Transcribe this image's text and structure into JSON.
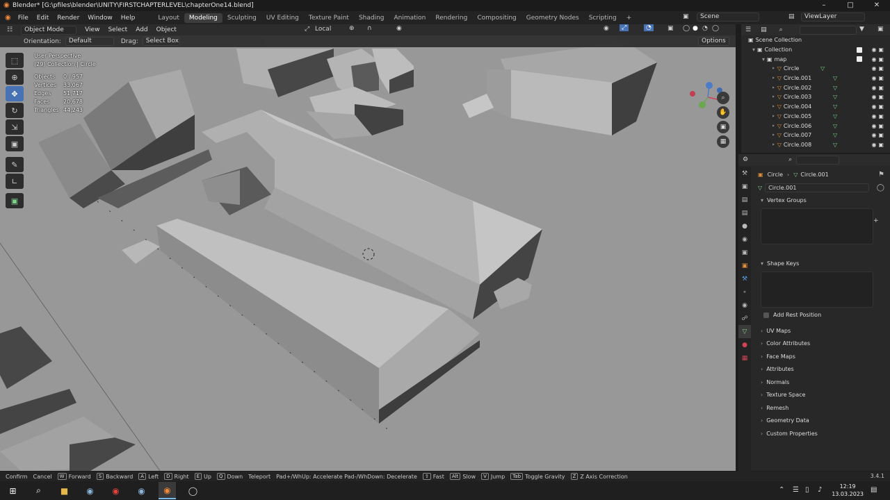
{
  "window": {
    "title": "Blender* [G:\\pfiles\\blender\\UNITY\\FIRSTCHAPTERLEVEL\\chapterOne14.blend]",
    "min": "–",
    "max": "□",
    "close": "✕"
  },
  "menu": [
    "File",
    "Edit",
    "Render",
    "Window",
    "Help"
  ],
  "workspaces": {
    "tabs": [
      "Layout",
      "Modeling",
      "Sculpting",
      "UV Editing",
      "Texture Paint",
      "Shading",
      "Animation",
      "Rendering",
      "Compositing",
      "Geometry Nodes",
      "Scripting"
    ],
    "active": "Modeling",
    "add": "+"
  },
  "scene": {
    "label": "Scene",
    "view_layer": "ViewLayer"
  },
  "viewport_header": {
    "mode": "Object Mode",
    "menus": [
      "View",
      "Select",
      "Add",
      "Object"
    ],
    "transform_orientation": "Local"
  },
  "tool_header": {
    "orientation_label": "Orientation:",
    "orientation_value": "Default",
    "drag_label": "Drag:",
    "drag_value": "Select Box",
    "options": "Options"
  },
  "overlay": {
    "perspective": "User Perspective",
    "context": "(29) Collection | Circle",
    "stats": [
      {
        "k": "Objects",
        "v": "0 / 957"
      },
      {
        "k": "Vertices",
        "v": "33,067"
      },
      {
        "k": "Edges",
        "v": "51,717"
      },
      {
        "k": "Faces",
        "v": "20,678"
      },
      {
        "k": "Triangles",
        "v": "44,243"
      }
    ]
  },
  "outliner": {
    "root": "Scene Collection",
    "collection": "Collection",
    "map": "map",
    "items": [
      "Circle",
      "Circle.001",
      "Circle.002",
      "Circle.003",
      "Circle.004",
      "Circle.005",
      "Circle.006",
      "Circle.007",
      "Circle.008"
    ]
  },
  "properties": {
    "breadcrumb_object": "Circle",
    "breadcrumb_data": "Circle.001",
    "mesh_name": "Circle.001",
    "sections": {
      "vertex_groups": "Vertex Groups",
      "shape_keys": "Shape Keys",
      "add_rest_position": "Add Rest Position",
      "collapsed": [
        "UV Maps",
        "Color Attributes",
        "Face Maps",
        "Attributes",
        "Normals",
        "Texture Space",
        "Remesh",
        "Geometry Data",
        "Custom Properties"
      ]
    }
  },
  "statusbar": {
    "items": [
      {
        "key": "",
        "label": "Confirm"
      },
      {
        "key": "",
        "label": "Cancel"
      },
      {
        "key": "W",
        "label": "Forward"
      },
      {
        "key": "S",
        "label": "Backward"
      },
      {
        "key": "A",
        "label": "Left"
      },
      {
        "key": "D",
        "label": "Right"
      },
      {
        "key": "E",
        "label": "Up"
      },
      {
        "key": "Q",
        "label": "Down"
      },
      {
        "key": "",
        "label": "Teleport"
      },
      {
        "key": "",
        "label": "Pad+/WhUp: Accelerate Pad-/WhDown: Decelerate"
      },
      {
        "key": "⇧",
        "label": "Fast"
      },
      {
        "key": "Alt",
        "label": "Slow"
      },
      {
        "key": "V",
        "label": "Jump"
      },
      {
        "key": "Tab",
        "label": "Toggle Gravity"
      },
      {
        "key": "Z",
        "label": "Z Axis Correction"
      }
    ],
    "version": "3.4.1"
  },
  "taskbar": {
    "time": "12:19",
    "date": "13.03.2023"
  },
  "colors": {
    "accent": "#4772b3",
    "active_tab": "#3d3d3d",
    "object_icon": "#e08f3b",
    "data_icon": "#7fd68a"
  }
}
